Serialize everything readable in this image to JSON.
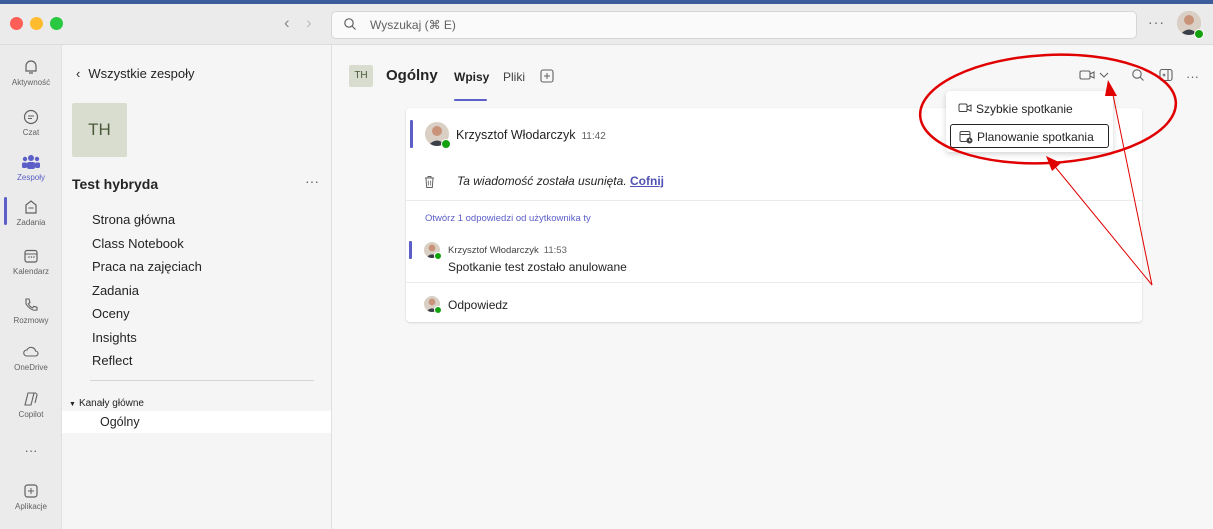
{
  "topbar": {
    "search_placeholder": "Wyszukaj (⌘ E)",
    "more": "···",
    "traffic_colors": [
      "#ff5f57",
      "#febc2e",
      "#28c840"
    ]
  },
  "rail": {
    "items": [
      {
        "label": "Aktywność",
        "icon": "bell-icon"
      },
      {
        "label": "Czat",
        "icon": "chat-icon"
      },
      {
        "label": "Zespoły",
        "icon": "teams-icon",
        "active": true
      },
      {
        "label": "Zadania",
        "icon": "assignments-icon"
      },
      {
        "label": "Kalendarz",
        "icon": "calendar-icon"
      },
      {
        "label": "Rozmowy",
        "icon": "phone-icon"
      },
      {
        "label": "OneDrive",
        "icon": "cloud-icon"
      },
      {
        "label": "Copilot",
        "icon": "copilot-icon"
      },
      {
        "label": "",
        "icon": "more-icon"
      },
      {
        "label": "Aplikacje",
        "icon": "apps-icon"
      }
    ],
    "more_dots": "···"
  },
  "panel": {
    "back_label": "Wszystkie zespoły",
    "team_initials": "TH",
    "team_name": "Test hybryda",
    "team_more": "···",
    "nav": [
      "Strona główna",
      "Class Notebook",
      "Praca na zajęciach",
      "Zadania",
      "Oceny",
      "Insights",
      "Reflect"
    ],
    "channels_label": "Kanały główne",
    "channel": "Ogólny"
  },
  "header": {
    "initials": "TH",
    "title": "Ogólny",
    "tabs": [
      "Wpisy",
      "Pliki"
    ],
    "active_tab": "Wpisy"
  },
  "post": {
    "author": "Krzysztof Włodarczyk",
    "time": "11:42",
    "deleted_text": "Ta wiadomość została usunięta.",
    "undo": "Cofnij",
    "open_replies": "Otwórz 1 odpowiedzi od użytkownika ty",
    "reply_author": "Krzysztof Włodarczyk",
    "reply_time": "11:53",
    "reply_text": "Spotkanie test zostało anulowane",
    "reply_button": "Odpowiedz"
  },
  "dropdown": {
    "items": [
      "Szybkie spotkanie",
      "Planowanie spotkania"
    ],
    "selected": "Planowanie spotkania"
  },
  "colors": {
    "accent": "#5b5fc7",
    "presence": "#13a10e",
    "annotation": "#e00000"
  }
}
